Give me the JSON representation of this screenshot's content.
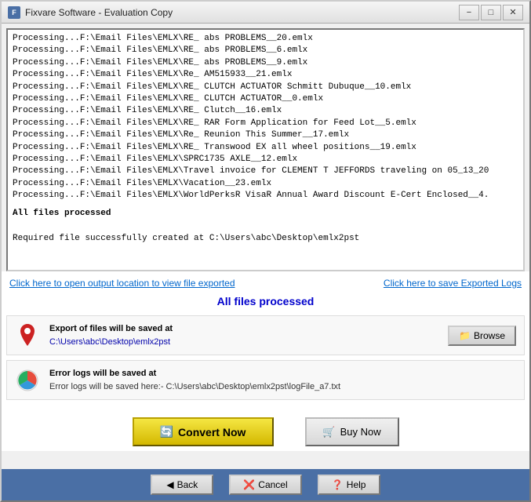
{
  "titleBar": {
    "icon": "F",
    "title": "Fixvare Software - Evaluation Copy",
    "minimize": "−",
    "maximize": "□",
    "close": "✕"
  },
  "log": {
    "lines": [
      "Processing...F:\\Email Files\\EMLX\\RE_ abs PROBLEMS__20.emlx",
      "Processing...F:\\Email Files\\EMLX\\RE_ abs PROBLEMS__6.emlx",
      "Processing...F:\\Email Files\\EMLX\\RE_ abs PROBLEMS__9.emlx",
      "Processing...F:\\Email Files\\EMLX\\Re_ AM515933__21.emlx",
      "Processing...F:\\Email Files\\EMLX\\RE_ CLUTCH ACTUATOR Schmitt Dubuque__10.emlx",
      "Processing...F:\\Email Files\\EMLX\\RE_ CLUTCH ACTUATOR__0.emlx",
      "Processing...F:\\Email Files\\EMLX\\RE_ Clutch__16.emlx",
      "Processing...F:\\Email Files\\EMLX\\RE_ RAR Form Application for Feed Lot__5.emlx",
      "Processing...F:\\Email Files\\EMLX\\Re_ Reunion This Summer__17.emlx",
      "Processing...F:\\Email Files\\EMLX\\RE_ Transwood EX all wheel positions__19.emlx",
      "Processing...F:\\Email Files\\EMLX\\SPRC1735 AXLE__12.emlx",
      "Processing...F:\\Email Files\\EMLX\\Travel invoice for CLEMENT T JEFFORDS traveling on 05_13_20",
      "Processing...F:\\Email Files\\EMLX\\Vacation__23.emlx",
      "Processing...F:\\Email Files\\EMLX\\WorldPerksR VisaR Annual Award Discount E-Cert Enclosed__4."
    ],
    "statusLine": "All files processed",
    "successLine": "Required file successfully created at C:\\Users\\abc\\Desktop\\emlx2pst"
  },
  "links": {
    "outputLink": "Click here to open output location to view file exported",
    "saveLogsLink": "Click here to save Exported Logs"
  },
  "statusBanner": "All files processed",
  "exportInfo": {
    "label": "Export of files will be saved at",
    "path": "C:\\Users\\abc\\Desktop\\emlx2pst",
    "browseLabel": "Browse"
  },
  "errorInfo": {
    "label": "Error logs will be saved at",
    "path": "Error logs will be saved here:- C:\\Users\\abc\\Desktop\\emlx2pst\\logFile_a7.txt"
  },
  "actions": {
    "convertLabel": "Convert Now",
    "buyLabel": "Buy Now"
  },
  "navBar": {
    "back": "Back",
    "cancel": "Cancel",
    "help": "Help"
  }
}
